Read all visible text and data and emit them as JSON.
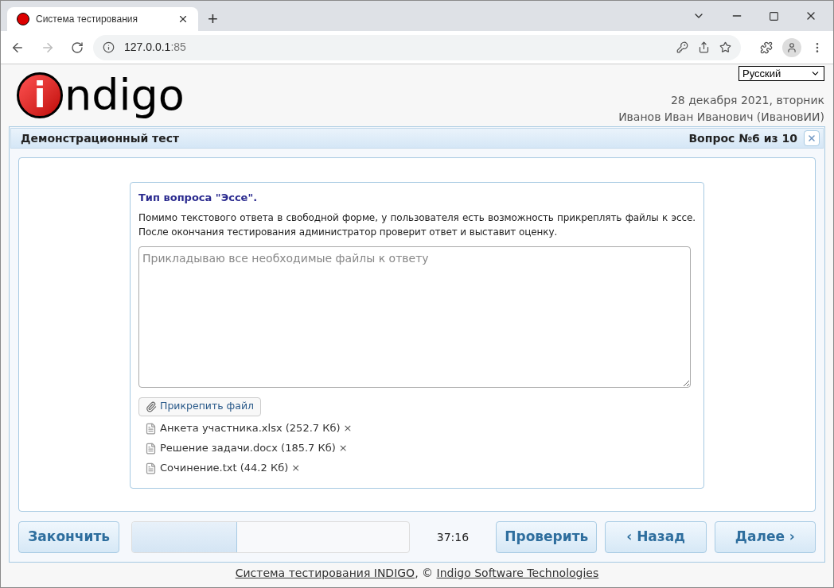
{
  "browser": {
    "tab_title": "Система тестирования",
    "new_tab": "+",
    "address_host": "127.0.0.1",
    "address_port": ":85"
  },
  "header": {
    "logo_mark": "i",
    "logo_text": "ndigo",
    "language": "Русский",
    "date": "28 декабря 2021, вторник",
    "user": "Иванов Иван Иванович (ИвановИИ)"
  },
  "test": {
    "title": "Демонстрационный тест",
    "question_counter": "Вопрос №6 из 10"
  },
  "question": {
    "type_title": "Тип вопроса \"Эссе\".",
    "text": "Помимо текстового ответа в свободной форме, у пользователя есть возможность прикреплять файлы к эссе. После окончания тестирования администратор проверит ответ и выставит оценку.",
    "answer_placeholder": "Прикладываю все необходимые файлы к ответу",
    "attach_button": "Прикрепить файл",
    "files": [
      {
        "name": "Анкета участника.xlsx (252.7 Кб)",
        "remove": "×"
      },
      {
        "name": "Решение задачи.docx (185.7 Кб)",
        "remove": "×"
      },
      {
        "name": "Сочинение.txt (44.2 Кб)",
        "remove": "×"
      }
    ]
  },
  "footer_bar": {
    "finish": "Закончить",
    "progress": {
      "level": 0.38
    },
    "timer": "37:16",
    "check": "Проверить",
    "back": "‹ Назад",
    "next": "Далее ›"
  },
  "footer": {
    "link_1": "Система тестирования INDIGO",
    "separator": ", ©",
    "link_2": "Indigo Software Technologies"
  }
}
